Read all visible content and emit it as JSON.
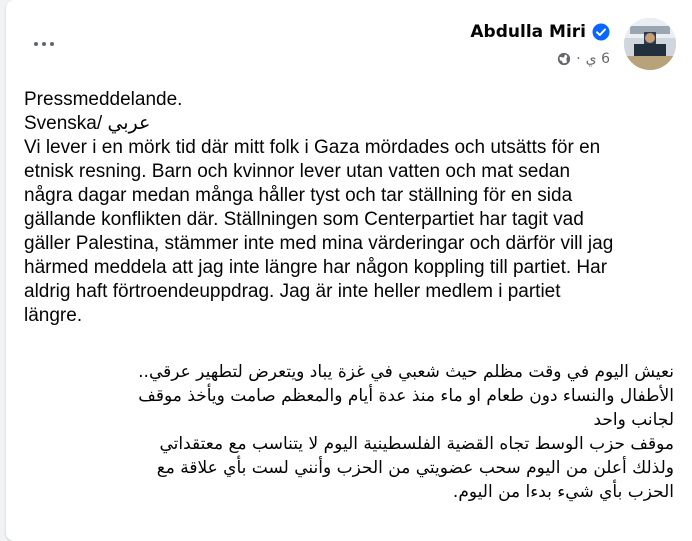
{
  "post": {
    "author": "Abdulla Miri",
    "time": "6 ي",
    "separator": "·",
    "lines": [
      "Pressmeddelande.",
      "Svenska/ عربي",
      "Vi lever i en mörk tid där mitt folk i Gaza mördades och utsätts för en",
      "etnisk resning. Barn och kvinnor lever utan vatten och mat sedan",
      "några dagar medan många håller tyst och tar ställning för en sida",
      "gällande konflikten där. Ställningen som Centerpartiet har tagit vad",
      "gäller Palestina, stämmer inte med mina värderingar och därför vill jag",
      "härmed meddela att jag inte längre har någon koppling till partiet. Har",
      "aldrig haft förtroendeuppdrag. Jag är inte heller medlem i partiet",
      "längre."
    ],
    "arabic_lines": [
      "نعيش اليوم في وقت مظلم حيث شعبي في غزة يباد ويتعرض لتطهير عرقي..",
      "الأطفال والنساء دون طعام او ماء منذ عدة أيام والمعظم صامت ويأخذ موقف",
      "لجانب واحد",
      "موقف حزب الوسط تجاه القضية الفلسطينية اليوم لا يتناسب مع معتقداتي",
      "ولذلك أعلن من اليوم سحب عضويتي من الحزب وأنني لست بأي علاقة مع",
      "الحزب بأي شيء بدءا من اليوم."
    ]
  },
  "colors": {
    "verified": "#0866ff",
    "meta_text": "#65676b"
  },
  "icons": {
    "more": "more-options-icon",
    "verified": "verified-badge-icon",
    "globe": "globe-icon"
  }
}
